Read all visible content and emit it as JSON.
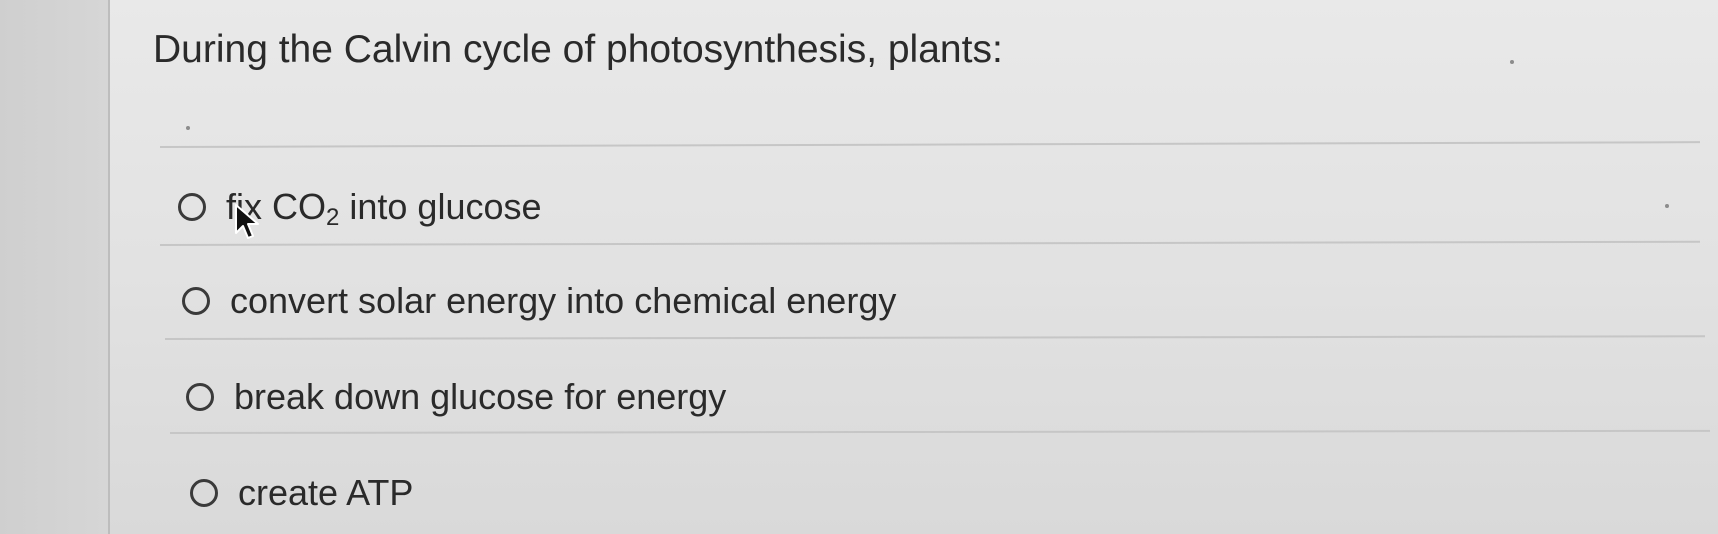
{
  "question": {
    "text": "During the Calvin cycle of photosynthesis, plants:"
  },
  "options": [
    {
      "prefix": "fix CO",
      "subscript": "2",
      "suffix": " into glucose",
      "selected": false
    },
    {
      "label": "convert solar energy into chemical energy",
      "selected": false
    },
    {
      "label": "break down glucose for energy",
      "selected": false
    },
    {
      "label": "create ATP",
      "selected": false
    }
  ],
  "colors": {
    "text": "#2a2a2a",
    "radio_border": "#3a3a3a",
    "divider": "#c6c6c6",
    "background": "#e5e5e5"
  },
  "icons": {
    "pointer": "mouse-pointer-icon"
  }
}
